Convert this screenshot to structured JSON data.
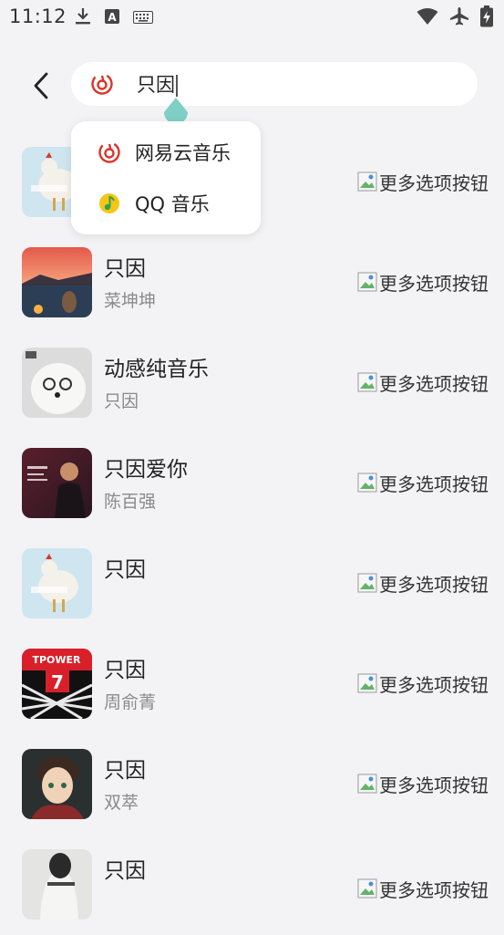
{
  "status_bar": {
    "time": "11:12",
    "left_icons": [
      "download-icon",
      "a-square-icon",
      "keyboard-icon"
    ],
    "right_icons": [
      "wifi-icon",
      "airplane-icon",
      "battery-charging-icon"
    ]
  },
  "search": {
    "value": "只因",
    "source_icon": "netease-music-icon"
  },
  "source_dropdown": {
    "options": [
      {
        "label": "网易云音乐",
        "icon": "netease-music-icon",
        "color": "#d9342b"
      },
      {
        "label": "QQ 音乐",
        "icon": "qq-music-icon",
        "color": "#f5c518"
      }
    ]
  },
  "songs": [
    {
      "title": "",
      "artist": "",
      "more_label": "更多选项按钮",
      "cover": "rooster"
    },
    {
      "title": "只因",
      "artist": "菜坤坤",
      "more_label": "更多选项按钮",
      "cover": "sunset"
    },
    {
      "title": "动感纯音乐",
      "artist": "只因",
      "more_label": "更多选项按钮",
      "cover": "dog"
    },
    {
      "title": "只因爱你",
      "artist": "陈百强",
      "more_label": "更多选项按钮",
      "cover": "portrait"
    },
    {
      "title": "只因",
      "artist": "",
      "more_label": "更多选项按钮",
      "cover": "rooster"
    },
    {
      "title": "只因",
      "artist": "周俞菁",
      "more_label": "更多选项按钮",
      "cover": "tpower"
    },
    {
      "title": "只因",
      "artist": "双萃",
      "more_label": "更多选项按钮",
      "cover": "anime"
    },
    {
      "title": "只因",
      "artist": "",
      "more_label": "更多选项按钮",
      "cover": "photo"
    }
  ],
  "colors": {
    "background": "#f3f3f6",
    "card": "#ffffff",
    "accent_teal": "#7fcfc6",
    "netease_red": "#d9342b",
    "qq_yellow": "#f5c518"
  }
}
